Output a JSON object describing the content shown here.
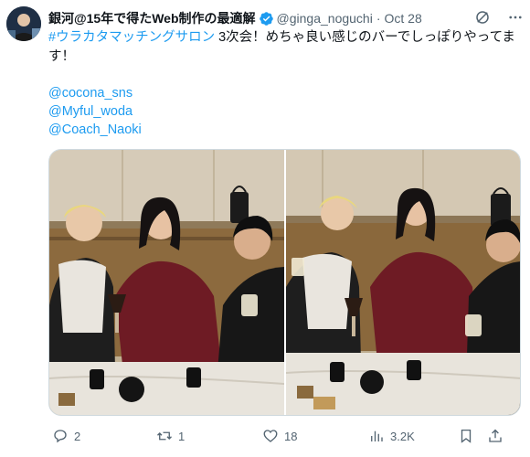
{
  "author": {
    "display_name": "銀河@15年で得たWeb制作の最適解",
    "handle": "@ginga_noguchi",
    "separator": "·",
    "date": "Oct 28"
  },
  "tweet": {
    "hashtag": "#ウラカタマッチングサロン",
    "text": " 3次会！めちゃ良い感じのバーでしっぽりやってます！",
    "mentions": [
      "@cocona_sns",
      "@Myful_woda",
      "@Coach_Naoki"
    ]
  },
  "actions": {
    "reply_count": "2",
    "retweet_count": "1",
    "like_count": "18",
    "view_count": "3.2K"
  },
  "icons": {
    "verified": "verified-badge-icon",
    "grok": "grok-icon",
    "more": "more-icon",
    "reply": "reply-icon",
    "retweet": "retweet-icon",
    "like": "heart-icon",
    "views": "views-icon",
    "bookmark": "bookmark-icon",
    "share": "share-icon"
  },
  "colors": {
    "accent": "#1d9bf0",
    "muted": "#536471",
    "text": "#0f1419"
  }
}
